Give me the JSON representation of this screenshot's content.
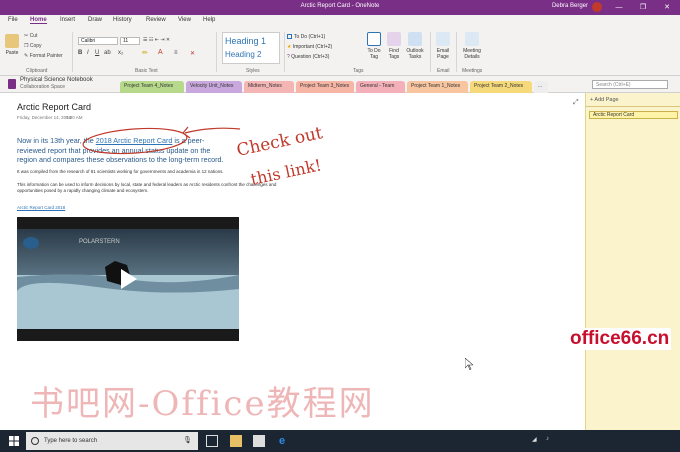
{
  "window": {
    "title": "Arctic Report Card - OneNote",
    "user": "Debra Berger",
    "minimize": "—",
    "restore": "❐",
    "close": "✕"
  },
  "menu": {
    "tabs": [
      "File",
      "Home",
      "Insert",
      "Draw",
      "History",
      "Review",
      "View",
      "Help"
    ],
    "active": "Home"
  },
  "ribbon": {
    "clipboard": {
      "paste": "Paste",
      "cut": "Cut",
      "copy": "Copy",
      "format_painter": "Format Painter",
      "label": "Clipboard"
    },
    "basic_text": {
      "font": "Calibri",
      "size": "11",
      "label": "Basic Text"
    },
    "styles": {
      "heading1": "Heading 1",
      "heading2": "Heading 2",
      "label": "Styles"
    },
    "tags": {
      "items": [
        "To Do (Ctrl+1)",
        "Important (Ctrl+2)",
        "Question (Ctrl+3)"
      ],
      "todo_tag": "To Do Tag",
      "find_tags": "Find Tags",
      "outlook_tasks": "Outlook Tasks",
      "label": "Tags"
    },
    "email": {
      "email_page": "Email Page",
      "label": "Email"
    },
    "meetings": {
      "meeting_details": "Meeting Details",
      "label": "Meetings"
    }
  },
  "notebook": {
    "name": "Physical Science Notebook",
    "sub": "Collaboration Space",
    "sections": [
      {
        "label": "Project Team 4_Notes",
        "color": "#b7d98b"
      },
      {
        "label": "Velocity Unit_Notes",
        "color": "#c9a8dd"
      },
      {
        "label": "Midterm_Notes",
        "color": "#f4b5b5"
      },
      {
        "label": "Project Team 3_Notes",
        "color": "#f7b6a5"
      },
      {
        "label": "General - Team",
        "color": "#f4b0b8"
      },
      {
        "label": "Project Team 1_Notes",
        "color": "#f7c59f"
      },
      {
        "label": "Project Team 2_Notes",
        "color": "#f5d97a"
      }
    ],
    "more": "...",
    "search_placeholder": "Search (Ctrl+E)"
  },
  "page": {
    "title": "Arctic Report Card",
    "date": "Friday, December 14, 2018",
    "time": "9:30 AM",
    "para1_pre": "Now in its 13th year, the ",
    "para1_link": "2018 Arctic Report Card",
    "para1_post": " is a peer-reviewed report that provides an annual status update on the region and compares these observations to the long-term record.",
    "para2": "It was compiled from the research of 81 scientists working for governments and academia in 12 nations.",
    "para3": "This information can be used to inform decisions by local, state and federal leaders as Arctic residents confront the challenges and opportunities posed by a rapidly changing climate and ecosystem.",
    "link_text": "Arctic Report Card 2018",
    "ink_note_line1": "Check out",
    "ink_note_line2": "this link!",
    "video_overlay": "POLARSTERN"
  },
  "pages_panel": {
    "add_page": "+ Add Page",
    "items": [
      "Arctic Report Card"
    ]
  },
  "watermark": "书吧网-Office教程网",
  "badge": "office66.cn",
  "taskbar": {
    "search_placeholder": "Type here to search"
  },
  "colors": {
    "brand": "#7a2f87",
    "link": "#2e74b5",
    "ink": "#c0392b",
    "pagelist_bg": "#fbf3cc"
  }
}
